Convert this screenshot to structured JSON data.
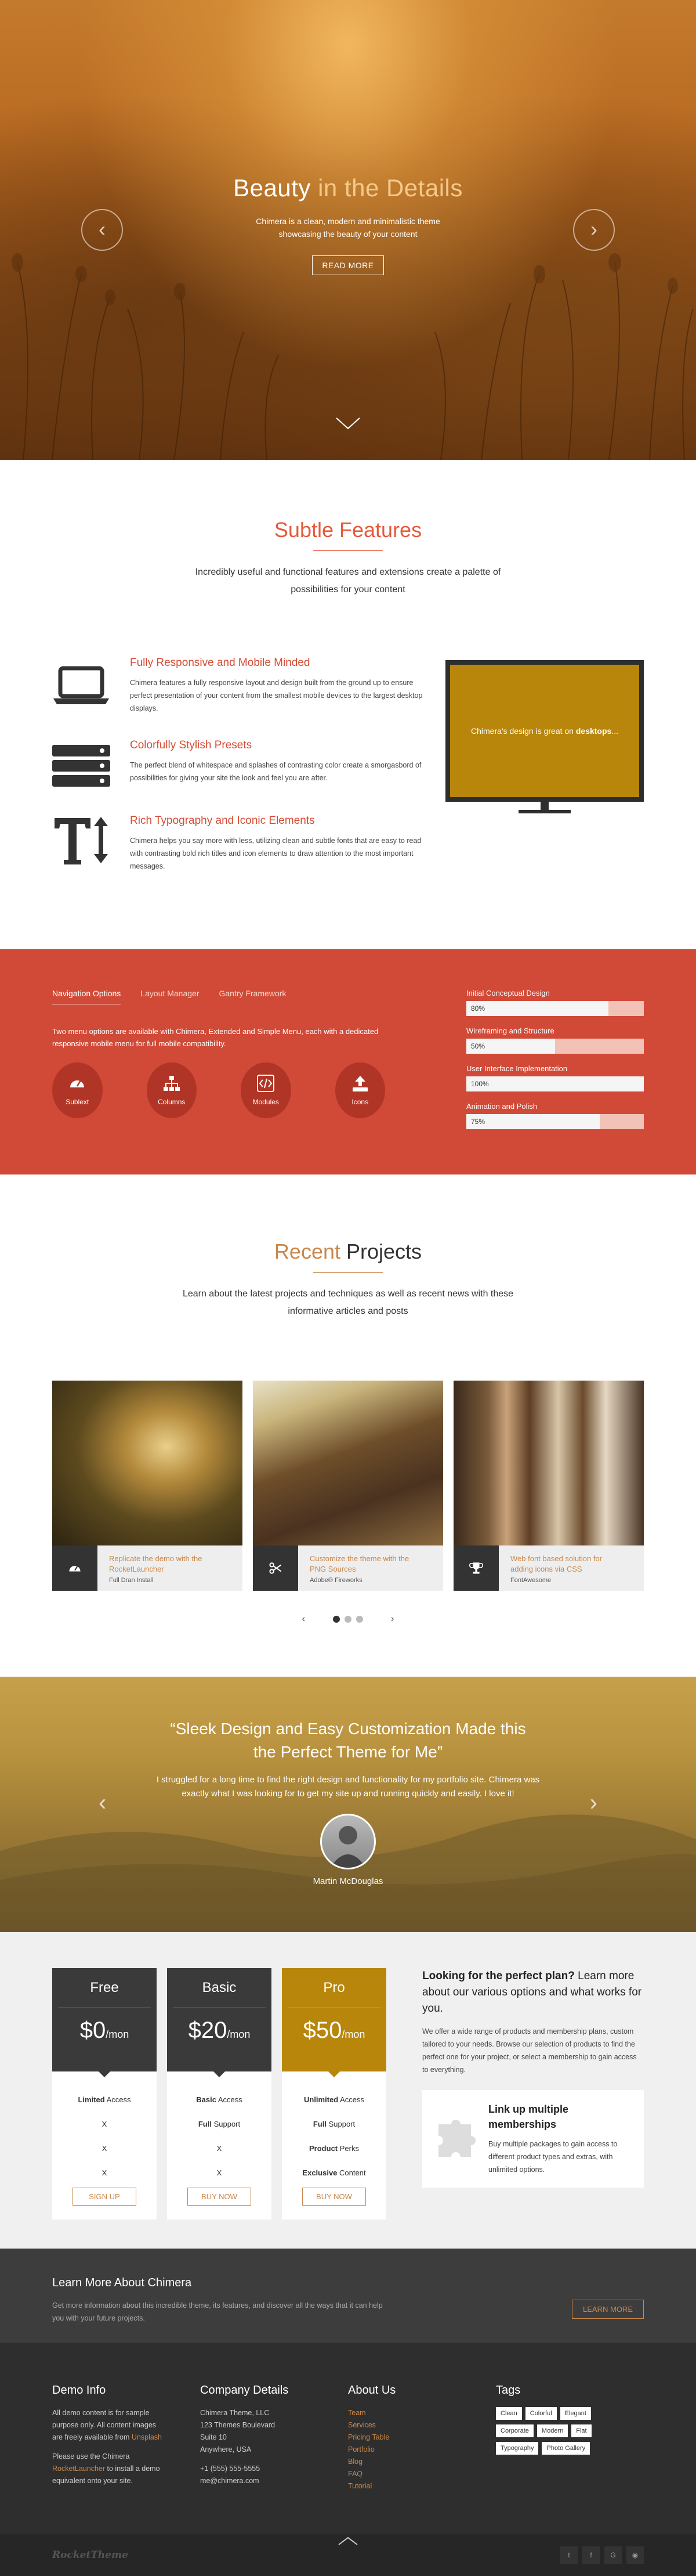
{
  "hero": {
    "title_main": "Beauty",
    "title_accent": "in the Details",
    "subtitle": "Chimera is a clean, modern and minimalistic theme showcasing the beauty of your content",
    "button": "Read More",
    "prev_arrow": "‹",
    "next_arrow": "›"
  },
  "features": {
    "title_dark": "Subtle",
    "title_accent": "Features",
    "lead": "Incredibly useful and functional features and extensions create a palette of possibilities for your content",
    "items": [
      {
        "icon": "laptop-icon",
        "title": "Fully Responsive and Mobile Minded",
        "text": "Chimera features a fully responsive layout and design built from the ground up to ensure perfect presentation of your content from the smallest mobile devices to the largest desktop displays."
      },
      {
        "icon": "server-stack-icon",
        "title": "Colorfully Stylish Presets",
        "text": "The perfect blend of whitespace and splashes of contrasting color create a smorgasbord of possibilities for giving your site the look and feel you are after."
      },
      {
        "icon": "text-height-icon",
        "title": "Rich Typography and Iconic Elements",
        "text": "Chimera helps you say more with less, utilizing clean and subtle fonts that are easy to read with contrasting bold rich titles and icon elements to draw attention to the most important messages."
      }
    ],
    "monitor_text": "Chimera's design is great on",
    "monitor_text_bold": "desktops",
    "monitor_text_end": "...",
    "monitor_color": "#b8860b"
  },
  "showcase": {
    "tabs": [
      "Navigation Options",
      "Layout Manager",
      "Gantry Framework"
    ],
    "description": "Two menu options are available with Chimera, Extended and Simple Menu, each with a dedicated responsive mobile menu for full mobile compatibility.",
    "circles": [
      {
        "icon": "dashboard-icon",
        "label": "Sublext"
      },
      {
        "icon": "sitemap-icon",
        "label": "Columns"
      },
      {
        "icon": "code-icon",
        "label": "Modules"
      },
      {
        "icon": "upload-icon",
        "label": "Icons"
      }
    ],
    "skills": [
      {
        "label": "Initial Conceptual Design",
        "percent": "80%",
        "value": 0.8
      },
      {
        "label": "Wireframing and Structure",
        "percent": "50%",
        "value": 0.5
      },
      {
        "label": "User Interface Implementation",
        "percent": "100%",
        "value": 1.0
      },
      {
        "label": "Animation and Polish",
        "percent": "75%",
        "value": 0.75
      }
    ],
    "band_color": "#d14a37"
  },
  "projects": {
    "title_dark": "Recent",
    "title_accent": "Projects",
    "lead": "Learn about the latest projects and techniques as well as recent news with these informative articles and posts",
    "items": [
      {
        "icon": "dashboard-icon",
        "title": "Replicate the demo with the RocketLauncher",
        "sub": "Full Dran Install"
      },
      {
        "icon": "scissors-icon",
        "title": "Customize the theme with the PNG Sources",
        "sub": "Adobe® Fireworks"
      },
      {
        "icon": "trophy-icon",
        "title": "Web font based solution for adding icons via CSS",
        "sub": "FontAwesome"
      }
    ],
    "prev": "‹",
    "next": "›"
  },
  "testimonial": {
    "quote": "“Sleek Design and Easy Customization Made this the Perfect Theme for Me”",
    "body": "I struggled for a long time to find the right design and functionality for my portfolio site. Chimera was exactly what I was looking for to get my site up and running quickly and easily. I love it!",
    "name": "Martin McDouglas",
    "prev": "‹",
    "next": "›"
  },
  "pricing": {
    "plans": [
      {
        "name": "Free",
        "price": "$0",
        "per": "/mon",
        "features": [
          [
            "Limited",
            " Access"
          ],
          [
            "X",
            ""
          ],
          [
            "X",
            ""
          ],
          [
            "X",
            ""
          ]
        ],
        "button": "Sign Up"
      },
      {
        "name": "Basic",
        "price": "$20",
        "per": "/mon",
        "features": [
          [
            "Basic",
            " Access"
          ],
          [
            "Full",
            " Support"
          ],
          [
            "X",
            ""
          ],
          [
            "X",
            ""
          ]
        ],
        "button": "Buy Now"
      },
      {
        "name": "Pro",
        "price": "$50",
        "per": "/mon",
        "features": [
          [
            "Unlimited",
            " Access"
          ],
          [
            "Full",
            " Support"
          ],
          [
            "Product",
            " Perks"
          ],
          [
            "Exclusive",
            " Content"
          ]
        ],
        "button": "Buy Now"
      }
    ],
    "info_title_bold": "Looking for the perfect plan?",
    "info_title_rest": "Learn more about our various options and what works for you.",
    "info_text": "We offer a wide range of products and membership plans, custom tailored to your needs. Browse our selection of products to find the perfect one for your project, or select a membership to gain access to everything.",
    "box_title": "Link up multiple memberships",
    "box_text": "Buy multiple packages to gain access to different product types and extras, with unlimited options.",
    "pro_color": "#b8860b"
  },
  "cta": {
    "title": "Learn More About Chimera",
    "text": "Get more information about this incredible theme, its features, and discover all the ways that it can help you with your future projects.",
    "button": "Learn More"
  },
  "footer": {
    "demo_title": "Demo Info",
    "demo_p1": "All demo content is for sample purpose only. All content images are freely available from",
    "demo_p1_link": "Unsplash",
    "demo_p2a": "Please use the Chimera",
    "demo_p2_link": "RocketLauncher",
    "demo_p2b": "to install a demo equivalent onto your site.",
    "company_title": "Company Details",
    "company_lines": [
      "Chimera Theme, LLC",
      "123 Themes Boulevard",
      "Suite 10",
      "Anywhere, USA"
    ],
    "phone": "+1 (555) 555-5555",
    "email": "me@chimera.com",
    "about_title": "About Us",
    "about_links": [
      "Team",
      "Services",
      "Pricing Table",
      "Portfolio",
      "Blog",
      "FAQ",
      "Tutorial"
    ],
    "tags_title": "Tags",
    "tags": [
      "Clean",
      "Colorful",
      "Elegant",
      "Corporate",
      "Modern",
      "Flat",
      "Typography",
      "Photo Gallery"
    ]
  },
  "bottom": {
    "logo": "RocketTheme",
    "social": [
      {
        "icon": "twitter-icon",
        "glyph": "t"
      },
      {
        "icon": "facebook-icon",
        "glyph": "f"
      },
      {
        "icon": "google-plus-icon",
        "glyph": "G"
      },
      {
        "icon": "rss-icon",
        "glyph": "◉"
      }
    ]
  }
}
